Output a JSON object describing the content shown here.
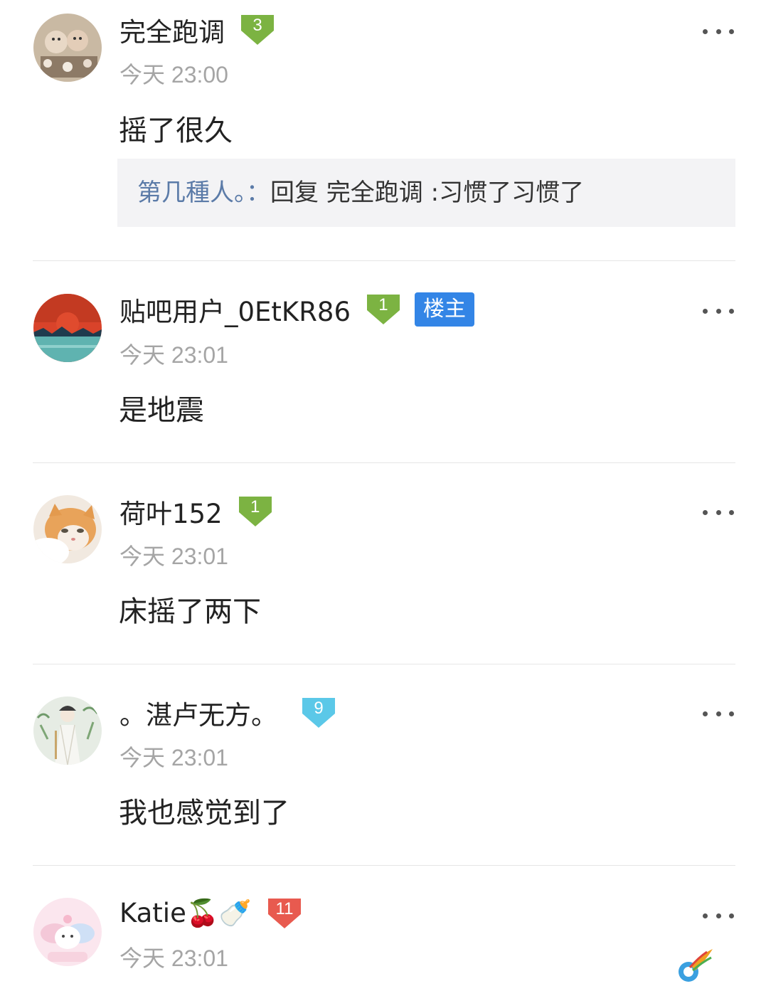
{
  "comments": [
    {
      "username": "完全跑调",
      "level": "3",
      "level_color": "#7cb342",
      "time": "今天 23:00",
      "content": "摇了很久",
      "reply": {
        "name": "第几種人。",
        "sep": "：",
        "text": "回复 完全跑调 :习惯了习惯了"
      }
    },
    {
      "username": "贴吧用户_0EtKR86",
      "level": "1",
      "level_color": "#7cb342",
      "owner_badge": "楼主",
      "time": "今天 23:01",
      "content": "是地震"
    },
    {
      "username": "荷叶152",
      "level": "1",
      "level_color": "#7cb342",
      "time": "今天 23:01",
      "content": "床摇了两下"
    },
    {
      "username": "。湛卢无方。",
      "level": "9",
      "level_color": "#5bc8e8",
      "time": "今天 23:01",
      "content": "我也感觉到了"
    },
    {
      "username": "Katie🍒🍼",
      "level": "11",
      "level_color": "#e85a4f",
      "time": "今天 23:01"
    }
  ],
  "icons": {
    "more": "more-dots-icon",
    "watermark": "tieba-watermark-icon"
  }
}
